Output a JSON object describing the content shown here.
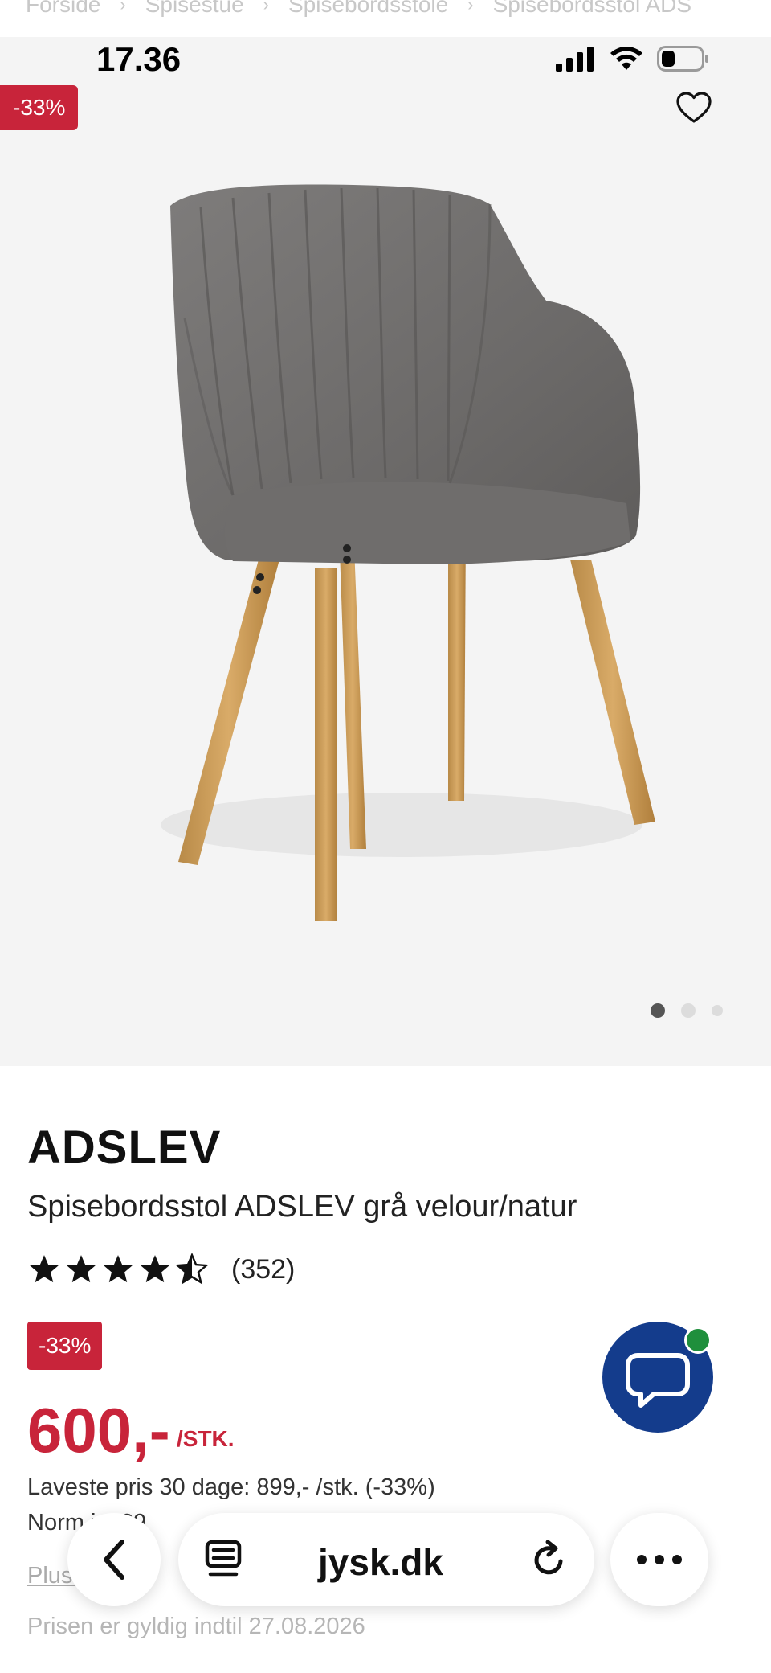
{
  "breadcrumb": {
    "items": [
      "Forside",
      "Spisestue",
      "Spisebordsstole",
      "Spisebordsstol ADS"
    ]
  },
  "status_bar": {
    "time": "17.36"
  },
  "gallery": {
    "discount_badge": "-33%",
    "total_images": 3,
    "active_image": 1
  },
  "product": {
    "brand": "ADSLEV",
    "title": "Spisebordsstol ADSLEV grå velour/natur",
    "rating_value": 4.5,
    "rating_count": "(352)",
    "discount_badge": "-33%",
    "price": "600,-",
    "price_unit": "/STK.",
    "lowest_price_text": "Laveste pris 30 dage: 899,- /stk. (-33%)",
    "normal_price_text": "Norm     is: 89",
    "plus_text": "Plus       gt",
    "valid_until_text": "Prisen er gyldig indtil 27.08.2026"
  },
  "browser": {
    "url": "jysk.dk"
  },
  "colors": {
    "accent_red": "#c8243a",
    "chat_blue": "#143c8c",
    "online_green": "#1f8f3c"
  },
  "icons": {
    "heart": "heart-icon",
    "chat": "chat-bubble-icon",
    "back": "chevron-left-icon",
    "tabs": "tabs-icon",
    "reload": "reload-icon",
    "more": "more-dots-icon"
  }
}
